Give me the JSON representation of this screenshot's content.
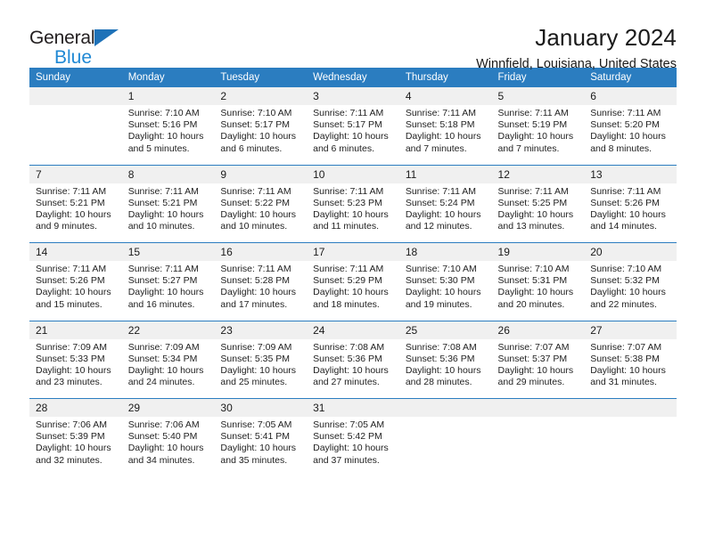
{
  "brand": {
    "word1": "General",
    "word2": "Blue",
    "triangle_color": "#1f72b8",
    "blue_color": "#1f88d4"
  },
  "header": {
    "title": "January 2024",
    "subtitle": "Winnfield, Louisiana, United States"
  },
  "theme": {
    "header_bg": "#2b7dc0",
    "daynum_bg": "#f0f0f0",
    "divider": "#2b7dc0"
  },
  "weekday_headers": [
    "Sunday",
    "Monday",
    "Tuesday",
    "Wednesday",
    "Thursday",
    "Friday",
    "Saturday"
  ],
  "weeks": [
    {
      "days": [
        {
          "num": "",
          "sunrise": "",
          "sunset": "",
          "daylight1": "",
          "daylight2": "",
          "empty": true
        },
        {
          "num": "1",
          "sunrise": "Sunrise: 7:10 AM",
          "sunset": "Sunset: 5:16 PM",
          "daylight1": "Daylight: 10 hours",
          "daylight2": "and 5 minutes."
        },
        {
          "num": "2",
          "sunrise": "Sunrise: 7:10 AM",
          "sunset": "Sunset: 5:17 PM",
          "daylight1": "Daylight: 10 hours",
          "daylight2": "and 6 minutes."
        },
        {
          "num": "3",
          "sunrise": "Sunrise: 7:11 AM",
          "sunset": "Sunset: 5:17 PM",
          "daylight1": "Daylight: 10 hours",
          "daylight2": "and 6 minutes."
        },
        {
          "num": "4",
          "sunrise": "Sunrise: 7:11 AM",
          "sunset": "Sunset: 5:18 PM",
          "daylight1": "Daylight: 10 hours",
          "daylight2": "and 7 minutes."
        },
        {
          "num": "5",
          "sunrise": "Sunrise: 7:11 AM",
          "sunset": "Sunset: 5:19 PM",
          "daylight1": "Daylight: 10 hours",
          "daylight2": "and 7 minutes."
        },
        {
          "num": "6",
          "sunrise": "Sunrise: 7:11 AM",
          "sunset": "Sunset: 5:20 PM",
          "daylight1": "Daylight: 10 hours",
          "daylight2": "and 8 minutes."
        }
      ]
    },
    {
      "days": [
        {
          "num": "7",
          "sunrise": "Sunrise: 7:11 AM",
          "sunset": "Sunset: 5:21 PM",
          "daylight1": "Daylight: 10 hours",
          "daylight2": "and 9 minutes."
        },
        {
          "num": "8",
          "sunrise": "Sunrise: 7:11 AM",
          "sunset": "Sunset: 5:21 PM",
          "daylight1": "Daylight: 10 hours",
          "daylight2": "and 10 minutes."
        },
        {
          "num": "9",
          "sunrise": "Sunrise: 7:11 AM",
          "sunset": "Sunset: 5:22 PM",
          "daylight1": "Daylight: 10 hours",
          "daylight2": "and 10 minutes."
        },
        {
          "num": "10",
          "sunrise": "Sunrise: 7:11 AM",
          "sunset": "Sunset: 5:23 PM",
          "daylight1": "Daylight: 10 hours",
          "daylight2": "and 11 minutes."
        },
        {
          "num": "11",
          "sunrise": "Sunrise: 7:11 AM",
          "sunset": "Sunset: 5:24 PM",
          "daylight1": "Daylight: 10 hours",
          "daylight2": "and 12 minutes."
        },
        {
          "num": "12",
          "sunrise": "Sunrise: 7:11 AM",
          "sunset": "Sunset: 5:25 PM",
          "daylight1": "Daylight: 10 hours",
          "daylight2": "and 13 minutes."
        },
        {
          "num": "13",
          "sunrise": "Sunrise: 7:11 AM",
          "sunset": "Sunset: 5:26 PM",
          "daylight1": "Daylight: 10 hours",
          "daylight2": "and 14 minutes."
        }
      ]
    },
    {
      "days": [
        {
          "num": "14",
          "sunrise": "Sunrise: 7:11 AM",
          "sunset": "Sunset: 5:26 PM",
          "daylight1": "Daylight: 10 hours",
          "daylight2": "and 15 minutes."
        },
        {
          "num": "15",
          "sunrise": "Sunrise: 7:11 AM",
          "sunset": "Sunset: 5:27 PM",
          "daylight1": "Daylight: 10 hours",
          "daylight2": "and 16 minutes."
        },
        {
          "num": "16",
          "sunrise": "Sunrise: 7:11 AM",
          "sunset": "Sunset: 5:28 PM",
          "daylight1": "Daylight: 10 hours",
          "daylight2": "and 17 minutes."
        },
        {
          "num": "17",
          "sunrise": "Sunrise: 7:11 AM",
          "sunset": "Sunset: 5:29 PM",
          "daylight1": "Daylight: 10 hours",
          "daylight2": "and 18 minutes."
        },
        {
          "num": "18",
          "sunrise": "Sunrise: 7:10 AM",
          "sunset": "Sunset: 5:30 PM",
          "daylight1": "Daylight: 10 hours",
          "daylight2": "and 19 minutes."
        },
        {
          "num": "19",
          "sunrise": "Sunrise: 7:10 AM",
          "sunset": "Sunset: 5:31 PM",
          "daylight1": "Daylight: 10 hours",
          "daylight2": "and 20 minutes."
        },
        {
          "num": "20",
          "sunrise": "Sunrise: 7:10 AM",
          "sunset": "Sunset: 5:32 PM",
          "daylight1": "Daylight: 10 hours",
          "daylight2": "and 22 minutes."
        }
      ]
    },
    {
      "days": [
        {
          "num": "21",
          "sunrise": "Sunrise: 7:09 AM",
          "sunset": "Sunset: 5:33 PM",
          "daylight1": "Daylight: 10 hours",
          "daylight2": "and 23 minutes."
        },
        {
          "num": "22",
          "sunrise": "Sunrise: 7:09 AM",
          "sunset": "Sunset: 5:34 PM",
          "daylight1": "Daylight: 10 hours",
          "daylight2": "and 24 minutes."
        },
        {
          "num": "23",
          "sunrise": "Sunrise: 7:09 AM",
          "sunset": "Sunset: 5:35 PM",
          "daylight1": "Daylight: 10 hours",
          "daylight2": "and 25 minutes."
        },
        {
          "num": "24",
          "sunrise": "Sunrise: 7:08 AM",
          "sunset": "Sunset: 5:36 PM",
          "daylight1": "Daylight: 10 hours",
          "daylight2": "and 27 minutes."
        },
        {
          "num": "25",
          "sunrise": "Sunrise: 7:08 AM",
          "sunset": "Sunset: 5:36 PM",
          "daylight1": "Daylight: 10 hours",
          "daylight2": "and 28 minutes."
        },
        {
          "num": "26",
          "sunrise": "Sunrise: 7:07 AM",
          "sunset": "Sunset: 5:37 PM",
          "daylight1": "Daylight: 10 hours",
          "daylight2": "and 29 minutes."
        },
        {
          "num": "27",
          "sunrise": "Sunrise: 7:07 AM",
          "sunset": "Sunset: 5:38 PM",
          "daylight1": "Daylight: 10 hours",
          "daylight2": "and 31 minutes."
        }
      ]
    },
    {
      "days": [
        {
          "num": "28",
          "sunrise": "Sunrise: 7:06 AM",
          "sunset": "Sunset: 5:39 PM",
          "daylight1": "Daylight: 10 hours",
          "daylight2": "and 32 minutes."
        },
        {
          "num": "29",
          "sunrise": "Sunrise: 7:06 AM",
          "sunset": "Sunset: 5:40 PM",
          "daylight1": "Daylight: 10 hours",
          "daylight2": "and 34 minutes."
        },
        {
          "num": "30",
          "sunrise": "Sunrise: 7:05 AM",
          "sunset": "Sunset: 5:41 PM",
          "daylight1": "Daylight: 10 hours",
          "daylight2": "and 35 minutes."
        },
        {
          "num": "31",
          "sunrise": "Sunrise: 7:05 AM",
          "sunset": "Sunset: 5:42 PM",
          "daylight1": "Daylight: 10 hours",
          "daylight2": "and 37 minutes."
        },
        {
          "num": "",
          "sunrise": "",
          "sunset": "",
          "daylight1": "",
          "daylight2": "",
          "empty": true
        },
        {
          "num": "",
          "sunrise": "",
          "sunset": "",
          "daylight1": "",
          "daylight2": "",
          "empty": true
        },
        {
          "num": "",
          "sunrise": "",
          "sunset": "",
          "daylight1": "",
          "daylight2": "",
          "empty": true
        }
      ]
    }
  ]
}
